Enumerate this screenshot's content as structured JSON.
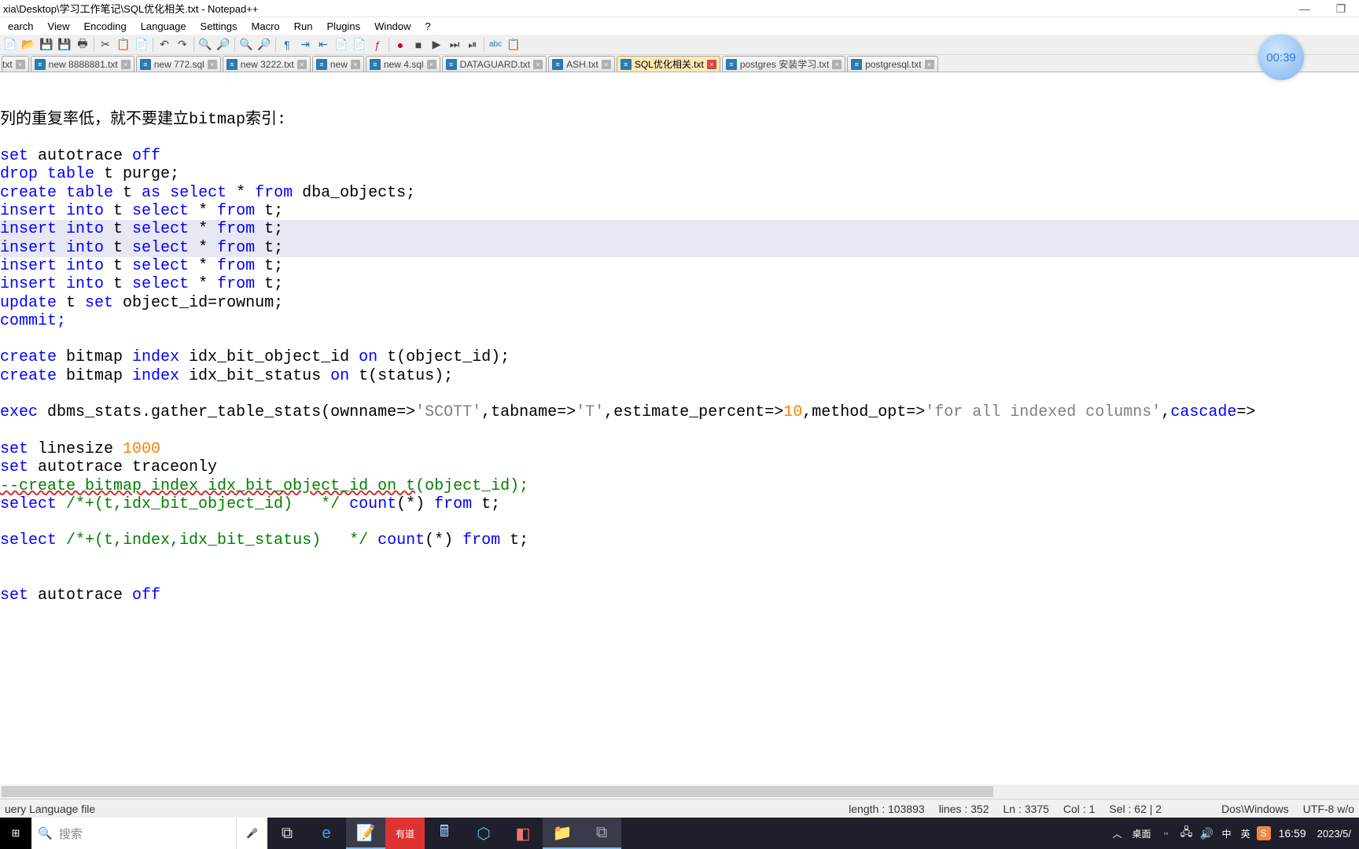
{
  "window": {
    "title": "xia\\Desktop\\学习工作笔记\\SQL优化相关.txt - Notepad++",
    "minimize": "—",
    "maximize": "❐",
    "close": "✕"
  },
  "menu": [
    "earch",
    "View",
    "Encoding",
    "Language",
    "Settings",
    "Macro",
    "Run",
    "Plugins",
    "Window",
    "?"
  ],
  "toolbar_icons": [
    "📄",
    "📂",
    "💾",
    "💾",
    "🖶",
    "✂",
    "📋",
    "📄",
    "↶",
    "↷",
    "🔍",
    "🔍",
    "🔎",
    "🔎",
    "|",
    "📐",
    "👁",
    "📋",
    "📋",
    "⟲",
    "🔴",
    "⏹",
    "▶",
    "⏭",
    "⏯",
    "📋",
    "abc",
    "📋"
  ],
  "tabs": [
    {
      "label": "txt",
      "active": false,
      "left_cut": true
    },
    {
      "label": "new 8888881.txt",
      "active": false
    },
    {
      "label": "new 772.sql",
      "active": false
    },
    {
      "label": "new 3222.txt",
      "active": false
    },
    {
      "label": "new",
      "active": false,
      "right_cut": true
    },
    {
      "label": "new 4.sql",
      "active": false
    },
    {
      "label": "DATAGUARD.txt",
      "active": false
    },
    {
      "label": "ASH.txt",
      "active": false
    },
    {
      "label": "SQL优化相关.txt",
      "active": true
    },
    {
      "label": "postgres 安装学习.txt",
      "active": false
    },
    {
      "label": "postgresql.txt",
      "active": false
    }
  ],
  "timer": "00:39",
  "status": {
    "left": "uery Language file",
    "length": "length : 103893",
    "lines": "lines : 352",
    "ln": "Ln : 3375",
    "col": "Col : 1",
    "sel": "Sel : 62 | 2",
    "eol": "Dos\\Windows",
    "enc": "UTF-8 w/o"
  },
  "taskbar": {
    "search_placeholder": "搜索",
    "tray_desktop": "桌面",
    "tray_ime1": "中",
    "tray_ime2": "英",
    "clock": "16:59",
    "date": "2023/5/"
  },
  "code": {
    "l1": "列的重复率低，就不要建立bitmap索引:",
    "l3_a": "set",
    "l3_b": " autotrace ",
    "l3_c": "off",
    "l4_a": "drop",
    "l4_b": " table",
    "l4_c": " t ",
    "l4_d": "purge;",
    "l5_a": "create",
    "l5_b": " table",
    "l5_c": " t ",
    "l5_d": "as",
    "l5_e": " select",
    "l5_f": " * ",
    "l5_g": "from",
    "l5_h": " dba_objects;",
    "l6_a": "insert",
    "l6_b": " into",
    "l6_c": " t ",
    "l6_d": "select",
    "l6_e": " * ",
    "l6_f": "from",
    "l6_g": " t;",
    "l11_a": "update",
    "l11_b": " t ",
    "l11_c": "set",
    "l11_d": " object_id=rownum;",
    "l12_a": "commit;",
    "l14_a": "create",
    "l14_b": " bitmap ",
    "l14_c": "index",
    "l14_d": " idx_bit_object_id ",
    "l14_e": "on",
    "l14_f": " t(object_id);",
    "l15_a": "create",
    "l15_b": " bitmap ",
    "l15_c": "index",
    "l15_d": " idx_bit_status ",
    "l15_e": "on",
    "l15_f": " t(status);",
    "l17_a": "exec",
    "l17_b": " dbms_stats.gather_table_stats(ownname=>",
    "l17_c": "'SCOTT'",
    "l17_d": ",tabname=>",
    "l17_e": "'T'",
    "l17_f": ",estimate_percent=>",
    "l17_g": "10",
    "l17_h": ",method_opt=>",
    "l17_i": "'for all indexed columns'",
    "l17_j": ",",
    "l17_k": "cascade",
    "l17_l": "=>",
    "l19_a": "set",
    "l19_b": " linesize ",
    "l19_c": "1000",
    "l20_a": "set",
    "l20_b": " autotrace traceonly",
    "l21_a": "--create bitmap index idx_bit_object_id on t",
    "l21_b": "(object_id);",
    "l22_a": "select",
    "l22_b": " /*+(t,idx_bit_object_id)   */",
    "l22_c": " count",
    "l22_d": "(*) ",
    "l22_e": "from",
    "l22_f": " t;",
    "l24_a": "select",
    "l24_b": " /*+(t,index,idx_bit_status)   */",
    "l24_c": " count",
    "l24_d": "(*) ",
    "l24_e": "from",
    "l24_f": " t;",
    "l27_a": "set",
    "l27_b": " autotrace ",
    "l27_c": "off"
  }
}
